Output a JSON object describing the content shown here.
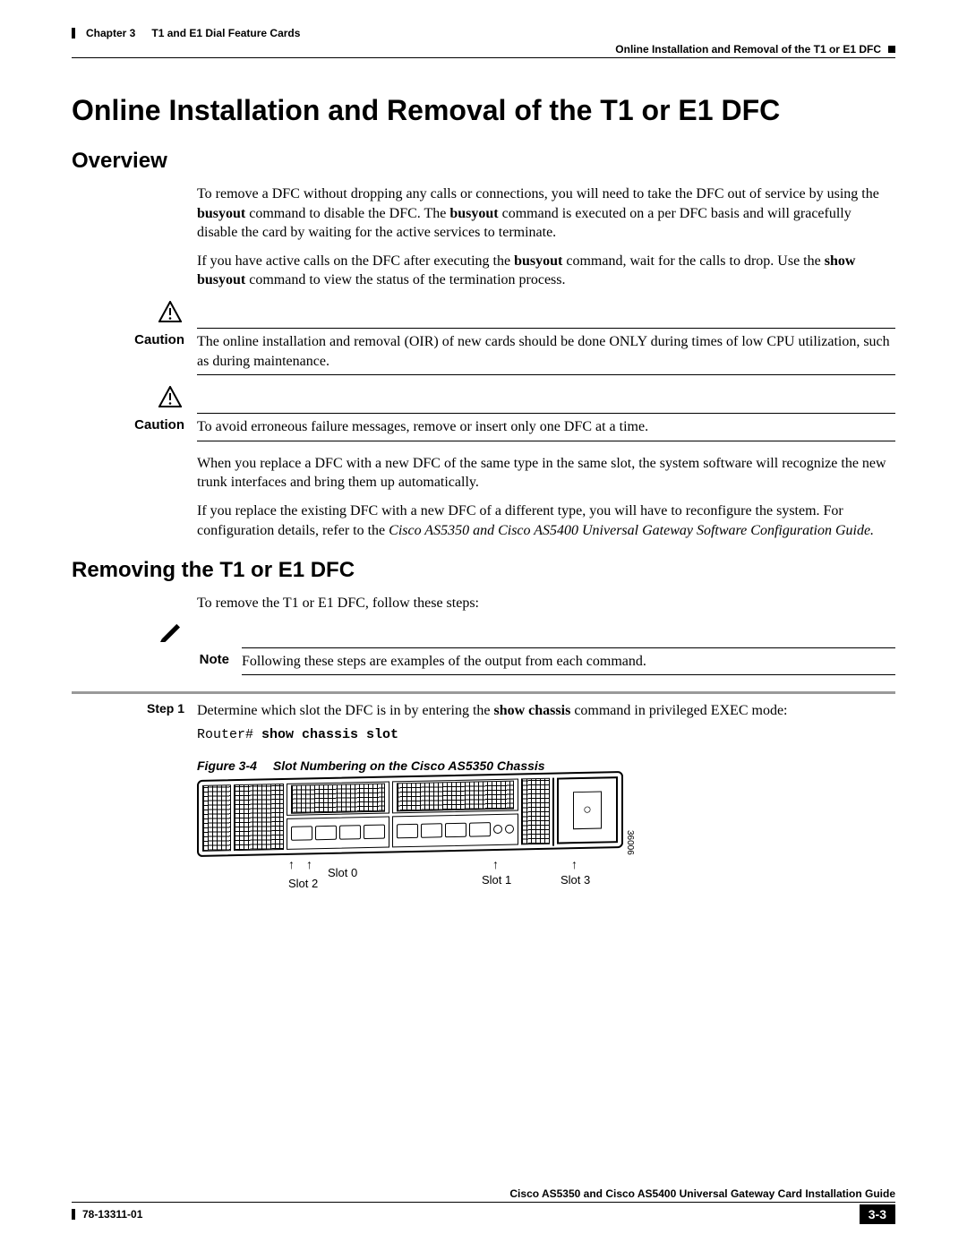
{
  "header": {
    "chapter": "Chapter 3",
    "chapter_title": "T1 and E1 Dial Feature Cards",
    "section": "Online Installation and Removal of the T1 or E1 DFC"
  },
  "title": "Online Installation and Removal of the T1 or E1 DFC",
  "overview": {
    "heading": "Overview",
    "p1_a": "To remove a DFC without dropping any calls or connections, you will need to take the DFC out of service by using the ",
    "p1_b": "busyout",
    "p1_c": " command to disable the DFC. The ",
    "p1_d": "busyout",
    "p1_e": " command is executed on a per DFC basis and will gracefully disable the card by waiting for the active services to terminate.",
    "p2_a": "If you have active calls on the DFC after executing the ",
    "p2_b": "busyout",
    "p2_c": " command, wait for the calls to drop. Use the ",
    "p2_d": "show busyout",
    "p2_e": " command to view the status of the termination process."
  },
  "caution1": {
    "label": "Caution",
    "text": "The online installation and removal (OIR) of new cards should be done ONLY during times of low CPU utilization, such as during maintenance."
  },
  "caution2": {
    "label": "Caution",
    "text": "To avoid erroneous failure messages, remove or insert only one DFC at a time."
  },
  "after_caution": {
    "p1": "When you replace a DFC with a new DFC of the same type in the same slot, the system software will recognize the new trunk interfaces and bring them up automatically.",
    "p2_a": "If you replace the existing DFC with a new DFC of a different type, you will have to reconfigure the system. For configuration details, refer to the ",
    "p2_b": "Cisco AS5350 and Cisco AS5400 Universal Gateway Software Configuration Guide.",
    "p2_c": ""
  },
  "removing": {
    "heading": "Removing the T1 or E1 DFC",
    "intro": "To remove the T1 or E1 DFC, follow these steps:"
  },
  "note": {
    "label": "Note",
    "text": "Following these steps are examples of the output from each command."
  },
  "step1": {
    "label": "Step 1",
    "text_a": "Determine which slot the DFC is in by entering the ",
    "text_b": "show chassis",
    "text_c": " command in privileged EXEC mode:",
    "prompt": "Router# ",
    "command": "show chassis slot"
  },
  "figure": {
    "num": "Figure 3-4",
    "title": "Slot Numbering on the Cisco AS5350 Chassis",
    "sidenum": "36006",
    "slot0": "Slot 0",
    "slot1": "Slot 1",
    "slot2": "Slot 2",
    "slot3": "Slot 3"
  },
  "footer": {
    "guide": "Cisco AS5350 and Cisco AS5400 Universal Gateway Card Installation Guide",
    "docnum": "78-13311-01",
    "pagenum": "3-3"
  }
}
